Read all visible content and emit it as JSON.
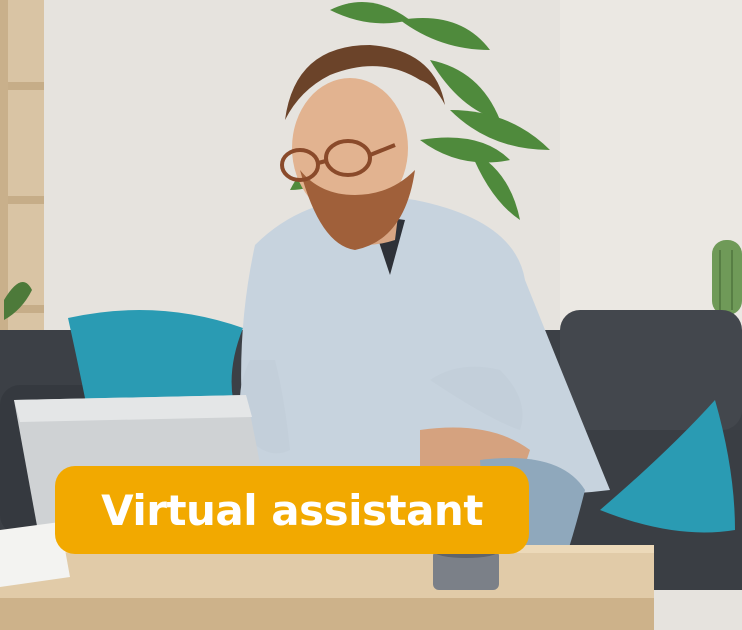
{
  "photo": {
    "subject": "man-with-glasses-using-laptop-on-sofa"
  },
  "badge": {
    "label": "Virtual assistant",
    "background_color": "#f2a900",
    "text_color": "#ffffff"
  }
}
